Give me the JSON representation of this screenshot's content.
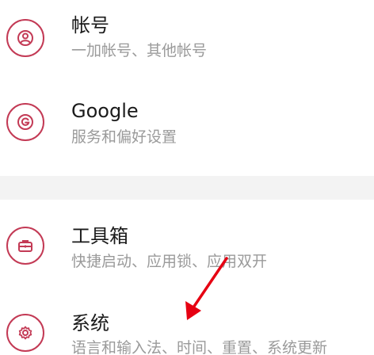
{
  "colors": {
    "accent": "#c33a55",
    "title_text": "#1a1a1a",
    "subtitle_text": "#9a9a9a",
    "section_gap": "#f3f3f3",
    "arrow": "#e60012"
  },
  "items": [
    {
      "icon": "account-icon",
      "title": "帐号",
      "subtitle": "一加帐号、其他帐号"
    },
    {
      "icon": "google-icon",
      "title": "Google",
      "subtitle": "服务和偏好设置"
    },
    {
      "icon": "toolbox-icon",
      "title": "工具箱",
      "subtitle": "快捷启动、应用锁、应用双开"
    },
    {
      "icon": "gear-icon",
      "title": "系统",
      "subtitle": "语言和输入法、时间、重置、系统更新"
    }
  ]
}
